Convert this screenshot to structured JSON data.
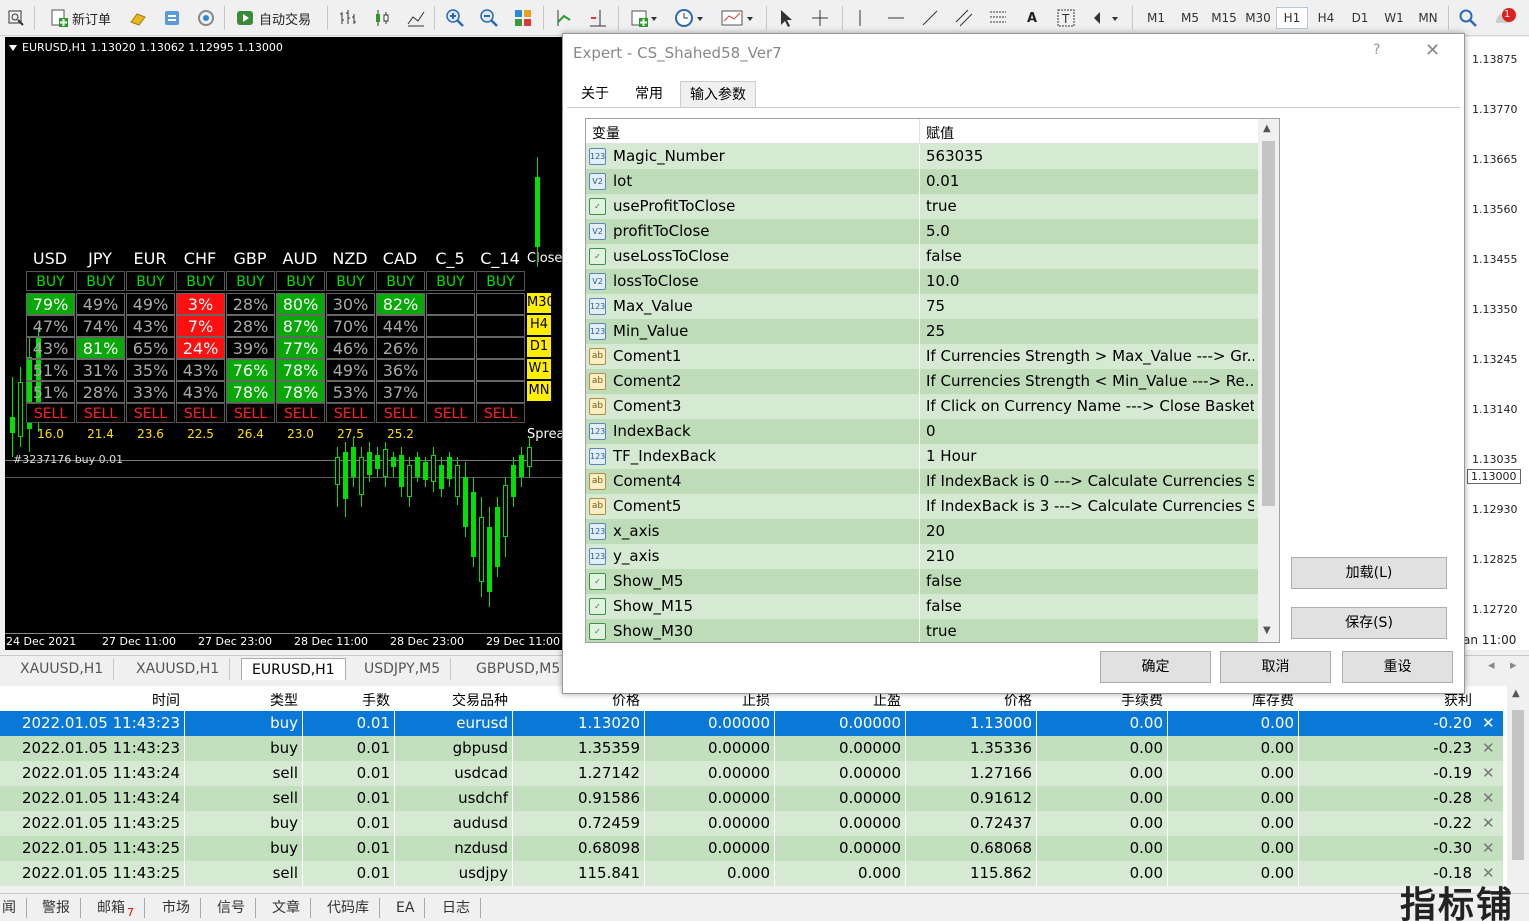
{
  "toolbar": {
    "new_order_label": "新订单",
    "auto_trade_label": "自动交易",
    "timeframes": [
      "M1",
      "M5",
      "M15",
      "M30",
      "H1",
      "H4",
      "D1",
      "W1",
      "MN"
    ],
    "active_timeframe": "H1",
    "notification_count": "1"
  },
  "chart": {
    "title": "EURUSD,H1  1.13020 1.13062 1.12995 1.13000",
    "order_label": "#3237176 buy 0.01",
    "dates": [
      "24 Dec 2021",
      "27 Dec 11:00",
      "27 Dec 23:00",
      "28 Dec 11:00",
      "28 Dec 23:00",
      "29 Dec 11:00"
    ],
    "axis_right_date": "an 11:00",
    "prices": [
      "1.13875",
      "1.13770",
      "1.13665",
      "1.13560",
      "1.13455",
      "1.13350",
      "1.13245",
      "1.13140",
      "1.13035",
      "1.13000",
      "1.12930",
      "1.12825",
      "1.12720"
    ],
    "current_price": "1.13000",
    "close_label": "Close",
    "spread_label": "Spread",
    "timeframe_buttons": [
      "M30",
      "H4",
      "D1",
      "W1",
      "MN"
    ]
  },
  "strength": {
    "currencies": [
      "USD",
      "JPY",
      "EUR",
      "CHF",
      "GBP",
      "AUD",
      "NZD",
      "CAD",
      "C_5",
      "C_14"
    ],
    "buy_label": "BUY",
    "sell_label": "SELL",
    "rows": [
      [
        "79%",
        "49%",
        "49%",
        "3%",
        "28%",
        "80%",
        "30%",
        "82%",
        "",
        ""
      ],
      [
        "47%",
        "74%",
        "43%",
        "7%",
        "28%",
        "87%",
        "70%",
        "44%",
        "",
        ""
      ],
      [
        "43%",
        "81%",
        "65%",
        "24%",
        "39%",
        "77%",
        "46%",
        "26%",
        "",
        ""
      ],
      [
        "51%",
        "31%",
        "35%",
        "43%",
        "76%",
        "78%",
        "49%",
        "36%",
        "",
        ""
      ],
      [
        "51%",
        "28%",
        "33%",
        "43%",
        "78%",
        "78%",
        "53%",
        "37%",
        "",
        ""
      ]
    ],
    "spreads": [
      "16.0",
      "21.4",
      "23.6",
      "22.5",
      "26.4",
      "23.0",
      "27.5",
      "25.2"
    ]
  },
  "symbol_tabs": [
    "XAUUSD,H1",
    "XAUUSD,H1",
    "EURUSD,H1",
    "USDJPY,M5",
    "GBPUSD,M5"
  ],
  "active_symbol_tab": "EURUSD,H1",
  "dialog": {
    "title": "Expert - CS_Shahed58_Ver7",
    "help": "?",
    "tabs": [
      "关于",
      "常用",
      "输入参数"
    ],
    "active_tab": "输入参数",
    "col_variable": "变量",
    "col_value": "赋值",
    "params": [
      {
        "type": "123",
        "name": "Magic_Number",
        "value": "563035"
      },
      {
        "type": "v2",
        "name": "lot",
        "value": "0.01"
      },
      {
        "type": "bool",
        "name": "useProfitToClose",
        "value": "true"
      },
      {
        "type": "v2",
        "name": "profitToClose",
        "value": "5.0"
      },
      {
        "type": "bool",
        "name": "useLossToClose",
        "value": "false"
      },
      {
        "type": "v2",
        "name": "lossToClose",
        "value": "10.0"
      },
      {
        "type": "123",
        "name": "Max_Value",
        "value": "75"
      },
      {
        "type": "123",
        "name": "Min_Value",
        "value": "25"
      },
      {
        "type": "ab",
        "name": "Coment1",
        "value": "If Currencies Strength > Max_Value ---> Gr..."
      },
      {
        "type": "ab",
        "name": "Coment2",
        "value": "If Currencies Strength < Min_Value ---> Re..."
      },
      {
        "type": "ab",
        "name": "Coment3",
        "value": "If Click on Currency Name ---> Close Basket..."
      },
      {
        "type": "123",
        "name": "IndexBack",
        "value": "0"
      },
      {
        "type": "123",
        "name": "TF_IndexBack",
        "value": "1 Hour"
      },
      {
        "type": "ab",
        "name": "Coment4",
        "value": "If IndexBack is 0 ---> Calculate Currencies S..."
      },
      {
        "type": "ab",
        "name": "Coment5",
        "value": "If IndexBack is 3 ---> Calculate Currencies S..."
      },
      {
        "type": "123",
        "name": "x_axis",
        "value": "20"
      },
      {
        "type": "123",
        "name": "y_axis",
        "value": "210"
      },
      {
        "type": "bool",
        "name": "Show_M5",
        "value": "false"
      },
      {
        "type": "bool",
        "name": "Show_M15",
        "value": "false"
      },
      {
        "type": "bool",
        "name": "Show_M30",
        "value": "true"
      }
    ],
    "load_button": "加载(L)",
    "save_button": "保存(S)",
    "ok_button": "确定",
    "cancel_button": "取消",
    "reset_button": "重设"
  },
  "trades": {
    "headers": [
      "时间",
      "类型",
      "手数",
      "交易品种",
      "价格",
      "止损",
      "止盈",
      "价格",
      "手续费",
      "库存费",
      "获利"
    ],
    "rows": [
      [
        "2022.01.05 11:43:23",
        "buy",
        "0.01",
        "eurusd",
        "1.13020",
        "0.00000",
        "0.00000",
        "1.13000",
        "0.00",
        "0.00",
        "-0.20"
      ],
      [
        "2022.01.05 11:43:23",
        "buy",
        "0.01",
        "gbpusd",
        "1.35359",
        "0.00000",
        "0.00000",
        "1.35336",
        "0.00",
        "0.00",
        "-0.23"
      ],
      [
        "2022.01.05 11:43:24",
        "sell",
        "0.01",
        "usdcad",
        "1.27142",
        "0.00000",
        "0.00000",
        "1.27166",
        "0.00",
        "0.00",
        "-0.19"
      ],
      [
        "2022.01.05 11:43:24",
        "sell",
        "0.01",
        "usdchf",
        "0.91586",
        "0.00000",
        "0.00000",
        "0.91612",
        "0.00",
        "0.00",
        "-0.28"
      ],
      [
        "2022.01.05 11:43:25",
        "buy",
        "0.01",
        "audusd",
        "0.72459",
        "0.00000",
        "0.00000",
        "0.72437",
        "0.00",
        "0.00",
        "-0.22"
      ],
      [
        "2022.01.05 11:43:25",
        "buy",
        "0.01",
        "nzdusd",
        "0.68098",
        "0.00000",
        "0.00000",
        "0.68068",
        "0.00",
        "0.00",
        "-0.30"
      ],
      [
        "2022.01.05 11:43:25",
        "sell",
        "0.01",
        "usdjpy",
        "115.841",
        "0.000",
        "0.000",
        "115.862",
        "0.00",
        "0.00",
        "-0.18"
      ]
    ]
  },
  "bottom_tabs": [
    "闻",
    "警报",
    "邮箱",
    "市场",
    "信号",
    "文章",
    "代码库",
    "EA",
    "日志"
  ],
  "mail_badge": "7",
  "watermark": "指标铺",
  "colors": {
    "buy": "#00e000",
    "sell": "#ff2020",
    "strong": "#08a808",
    "weak": "#ff1010",
    "selected_row": "#0a78d7",
    "param_row": "#d6ead3"
  }
}
